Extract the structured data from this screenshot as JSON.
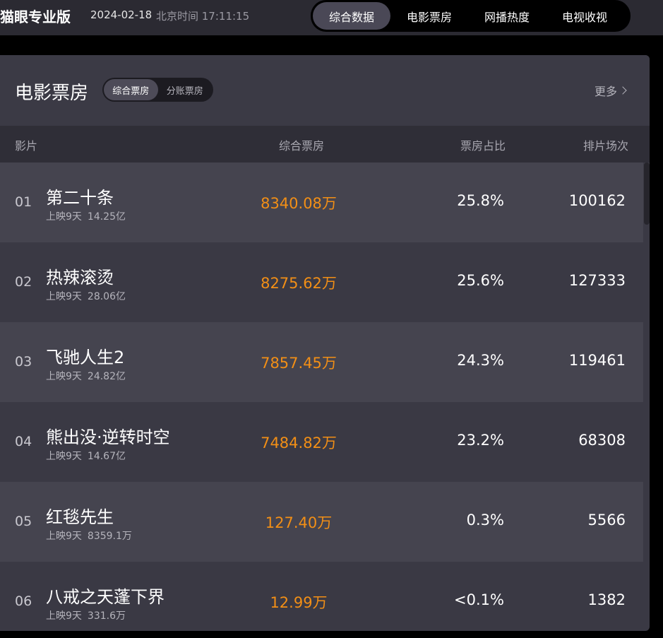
{
  "header": {
    "brand": "猫眼专业版",
    "date": "2024-02-18",
    "clock": "北京时间 17:11:15",
    "nav": [
      {
        "label": "综合数据",
        "active": true
      },
      {
        "label": "电影票房",
        "active": false
      },
      {
        "label": "网播热度",
        "active": false
      },
      {
        "label": "电视收视",
        "active": false
      }
    ]
  },
  "panel": {
    "title": "电影票房",
    "subtabs": [
      {
        "label": "综合票房",
        "active": true
      },
      {
        "label": "分账票房",
        "active": false
      }
    ],
    "more": "更多"
  },
  "table": {
    "columns": {
      "film": "影片",
      "box": "综合票房",
      "share": "票房占比",
      "sched": "排片场次"
    },
    "rows": [
      {
        "rank": "01",
        "name": "第二十条",
        "days": "上映9天",
        "total": "14.25亿",
        "box": "8340.08万",
        "share": "25.8%",
        "sched": "100162"
      },
      {
        "rank": "02",
        "name": "热辣滚烫",
        "days": "上映9天",
        "total": "28.06亿",
        "box": "8275.62万",
        "share": "25.6%",
        "sched": "127333"
      },
      {
        "rank": "03",
        "name": "飞驰人生2",
        "days": "上映9天",
        "total": "24.82亿",
        "box": "7857.45万",
        "share": "24.3%",
        "sched": "119461"
      },
      {
        "rank": "04",
        "name": "熊出没·逆转时空",
        "days": "上映9天",
        "total": "14.67亿",
        "box": "7484.82万",
        "share": "23.2%",
        "sched": "68308"
      },
      {
        "rank": "05",
        "name": "红毯先生",
        "days": "上映9天",
        "total": "8359.1万",
        "box": "127.40万",
        "share": "0.3%",
        "sched": "5566"
      },
      {
        "rank": "06",
        "name": "八戒之天蓬下界",
        "days": "上映9天",
        "total": "331.6万",
        "box": "12.99万",
        "share": "<0.1%",
        "sched": "1382"
      }
    ]
  },
  "colors": {
    "accent_box": "#f28f16",
    "panel": "#3a3944",
    "row_alt": "#45444f"
  }
}
